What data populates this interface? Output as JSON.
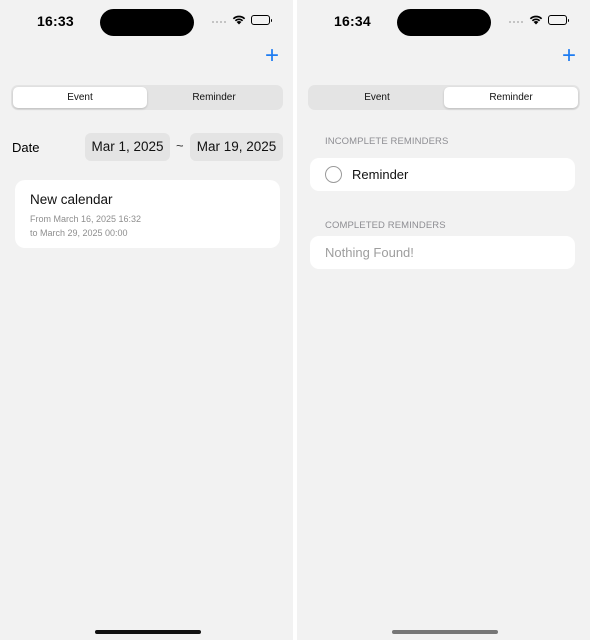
{
  "left_screen": {
    "status": {
      "time": "16:33"
    },
    "segments": {
      "event": "Event",
      "reminder": "Reminder",
      "selected": "Event"
    },
    "date_filter": {
      "label": "Date",
      "start": "Mar 1, 2025",
      "separator": "~",
      "end": "Mar 19, 2025"
    },
    "events": [
      {
        "title": "New calendar",
        "from": "From March 16, 2025 16:32",
        "to": "to March 29, 2025 00:00"
      }
    ]
  },
  "right_screen": {
    "status": {
      "time": "16:34"
    },
    "segments": {
      "event": "Event",
      "reminder": "Reminder",
      "selected": "Reminder"
    },
    "incomplete_header": "INCOMPLETE REMINDERS",
    "incomplete_items": [
      {
        "label": "Reminder",
        "completed": false
      }
    ],
    "completed_header": "COMPLETED REMINDERS",
    "completed_empty": "Nothing Found!"
  },
  "icons": {
    "add": "plus-icon",
    "signal": "cellular-signal-icon",
    "wifi": "wifi-icon",
    "battery": "battery-icon"
  },
  "colors": {
    "accent": "#1e7cf2",
    "screen_background": "#f2f2f2",
    "control_background": "#e4e4e4",
    "secondary_text": "#8e8e93"
  }
}
